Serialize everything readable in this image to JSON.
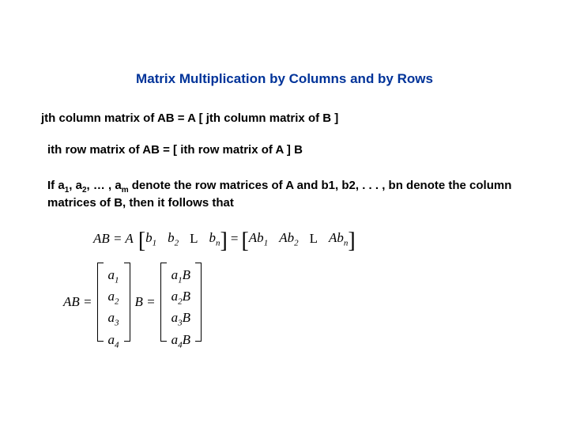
{
  "title": "Matrix Multiplication by Columns and by Rows",
  "line1": "jth column matrix of AB = A [ jth column matrix of B ]",
  "line2": "ith row matrix of AB = [ ith row matrix of A ] B",
  "para_parts": {
    "p0": "If a",
    "s1": "1",
    "p1": ", a",
    "s2": "2",
    "p2": ", … , a",
    "s3": "m",
    "p3": " denote the row matrices of A and b1, b2, . . . , bn denote the column matrices of B, then it follows that"
  },
  "eq1": {
    "lhs": "AB = A",
    "b1": "b",
    "b1s": "1",
    "b2": "b",
    "b2s": "2",
    "mid": "L",
    "bn": "b",
    "bns": "n",
    "eq": "=",
    "ab1": "Ab",
    "ab1s": "1",
    "ab2": "Ab",
    "ab2s": "2",
    "mid2": "L",
    "abn": "Ab",
    "abns": "n"
  },
  "eq2": {
    "lhs": "AB =",
    "a1": "a",
    "a1s": "1",
    "a2": "a",
    "a2s": "2",
    "a3": "a",
    "a3s": "3",
    "a4": "a",
    "a4s": "4",
    "B": "B =",
    "r1a": "a",
    "r1s": "1",
    "r1B": "B",
    "r2a": "a",
    "r2s": "2",
    "r2B": "B",
    "r3a": "a",
    "r3s": "3",
    "r3B": "B",
    "r4a": "a",
    "r4s": "4",
    "r4B": "B"
  }
}
